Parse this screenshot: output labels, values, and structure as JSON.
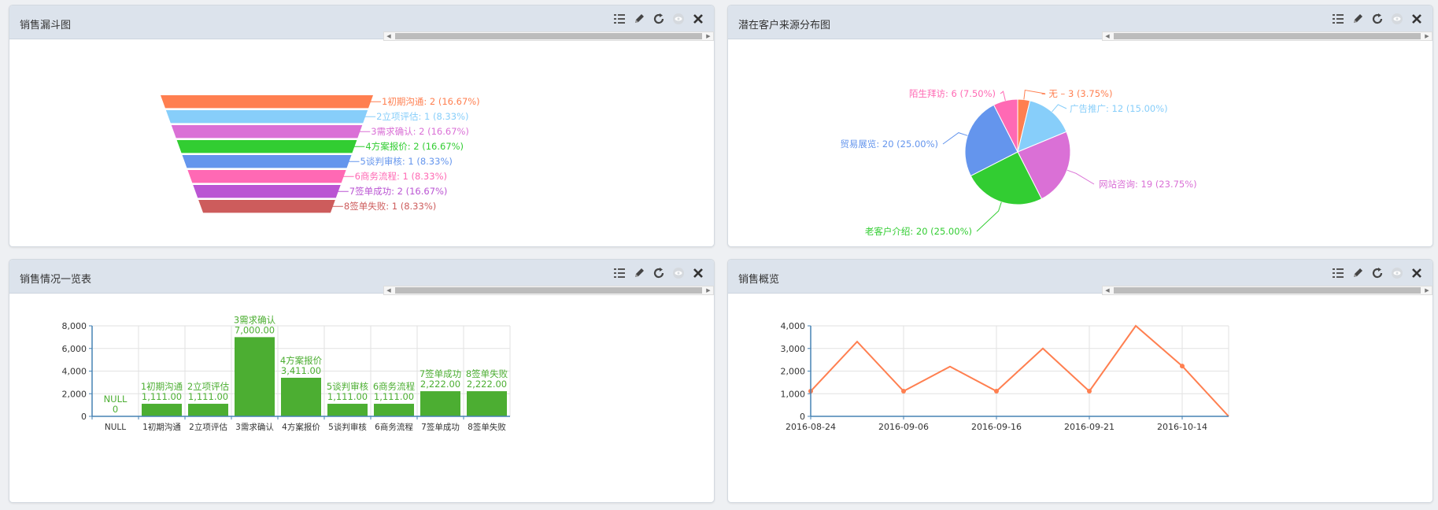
{
  "icons": {
    "list": "list-icon",
    "edit": "pencil-icon",
    "refresh": "refresh-icon",
    "hide": "eye-icon",
    "close": "close-icon"
  },
  "panels": {
    "funnel": {
      "title": "销售漏斗图"
    },
    "pie": {
      "title": "潜在客户来源分布图"
    },
    "bar": {
      "title": "销售情况一览表"
    },
    "line": {
      "title": "销售概览"
    }
  },
  "chart_data": [
    {
      "type": "funnel",
      "stages": [
        {
          "label": "1初期沟通: 2 (16.67%)",
          "value": 2,
          "color": "#ff7f50"
        },
        {
          "label": "2立项评估: 1 (8.33%)",
          "value": 1,
          "color": "#87cefa"
        },
        {
          "label": "3需求确认: 2 (16.67%)",
          "value": 2,
          "color": "#da70d6"
        },
        {
          "label": "4方案报价: 2 (16.67%)",
          "value": 2,
          "color": "#32cd32"
        },
        {
          "label": "5谈判审核: 1 (8.33%)",
          "value": 1,
          "color": "#6495ed"
        },
        {
          "label": "6商务流程: 1 (8.33%)",
          "value": 1,
          "color": "#ff69b4"
        },
        {
          "label": "7签单成功: 2 (16.67%)",
          "value": 2,
          "color": "#ba55d3"
        },
        {
          "label": "8签单失败: 1 (8.33%)",
          "value": 1,
          "color": "#cd5c5c"
        }
      ]
    },
    {
      "type": "pie",
      "slices": [
        {
          "label": "– 无 – 3 (3.75%)",
          "value": 3,
          "color": "#ff7f50"
        },
        {
          "label": "广告推广: 12 (15.00%)",
          "value": 12,
          "color": "#87cefa"
        },
        {
          "label": "网站咨询: 19 (23.75%)",
          "value": 19,
          "color": "#da70d6"
        },
        {
          "label": "老客户介绍: 20 (25.00%)",
          "value": 20,
          "color": "#32cd32"
        },
        {
          "label": "贸易展览: 20 (25.00%)",
          "value": 20,
          "color": "#6495ed"
        },
        {
          "label": "陌生拜访: 6 (7.50%)",
          "value": 6,
          "color": "#ff69b4"
        }
      ]
    },
    {
      "type": "bar",
      "categories": [
        "NULL",
        "1初期沟通",
        "2立项评估",
        "3需求确认",
        "4方案报价",
        "5谈判审核",
        "6商务流程",
        "7签单成功",
        "8签单失败"
      ],
      "values": [
        0,
        1111,
        1111,
        7000,
        3411,
        1111,
        1111,
        2222,
        2222
      ],
      "value_labels": [
        "0",
        "1,111.00",
        "1,111.00",
        "7,000.00",
        "3,411.00",
        "1,111.00",
        "1,111.00",
        "2,222.00",
        "2,222.00"
      ],
      "ylim": [
        0,
        8000
      ],
      "yticks": [
        "0",
        "2,000",
        "4,000",
        "6,000",
        "8,000"
      ],
      "color": "#4cae32"
    },
    {
      "type": "line",
      "x": [
        "2016-08-24",
        "",
        "2016-09-06",
        "",
        "2016-09-16",
        "",
        "2016-09-21",
        "",
        "2016-10-14",
        ""
      ],
      "xticks": [
        "2016-08-24",
        "2016-09-06",
        "2016-09-16",
        "2016-09-21",
        "2016-10-14"
      ],
      "values": [
        1111,
        3300,
        1111,
        2200,
        1111,
        3000,
        1111,
        4000,
        2222,
        0
      ],
      "ylim": [
        0,
        4000
      ],
      "yticks": [
        "0",
        "1,000",
        "2,000",
        "3,000",
        "4,000"
      ],
      "color": "#ff7f50"
    }
  ]
}
